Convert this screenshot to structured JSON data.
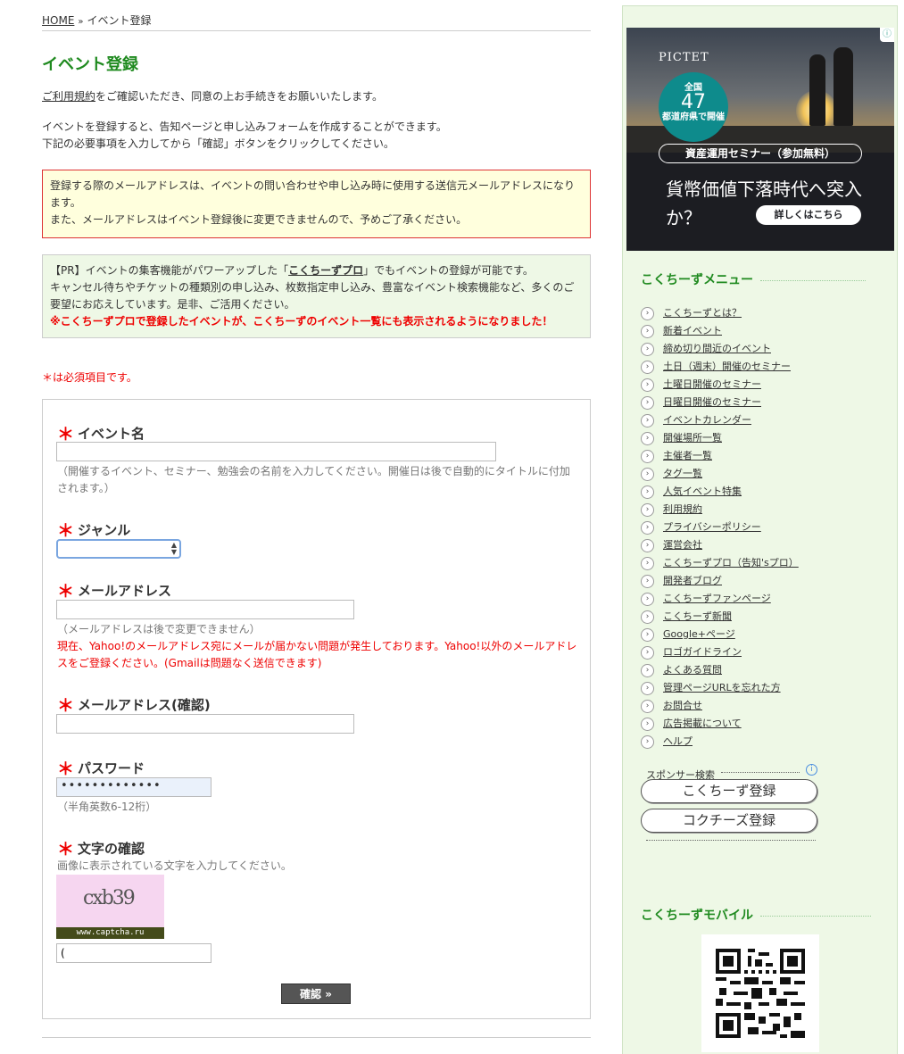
{
  "breadcrumb": {
    "home": "HOME",
    "sep": "»",
    "current": "イベント登録"
  },
  "page_title": "イベント登録",
  "intro": {
    "terms_link": "ご利用規約",
    "line1_rest": "をご確認いただき、同意の上お手続きをお願いいたします。",
    "line2": "イベントを登録すると、告知ページと申し込みフォームを作成することができます。",
    "line3": "下記の必要事項を入力してから「確認」ボタンをクリックしてください。"
  },
  "notice": {
    "line1": "登録する際のメールアドレスは、イベントの問い合わせや申し込み時に使用する送信元メールアドレスになります。",
    "line2": "また、メールアドレスはイベント登録後に変更できませんので、予めご了承ください。"
  },
  "pr": {
    "prefix": "【PR】イベントの集客機能がパワーアップした「",
    "pro_link": "こくちーずプロ",
    "suffix": "」でもイベントの登録が可能です。",
    "line2": "キャンセル待ちやチケットの種類別の申し込み、枚数指定申し込み、豊富なイベント検索機能など、多くのご要望にお応えしています。是非、ご活用ください。",
    "red": "※こくちーずプロで登録したイベントが、こくちーずのイベント一覧にも表示されるようになりました！"
  },
  "required_note": "＊は必須項目です。",
  "form": {
    "star": "＊",
    "event_name": {
      "label": "イベント名",
      "value": "",
      "help": "（開催するイベント、セミナー、勉強会の名前を入力してください。開催日は後で自動的にタイトルに付加されます。）"
    },
    "genre": {
      "label": "ジャンル",
      "value": ""
    },
    "email": {
      "label": "メールアドレス",
      "value": "",
      "help": "（メールアドレスは後で変更できません）",
      "warning": "現在、Yahoo!のメールアドレス宛にメールが届かない問題が発生しております。Yahoo!以外のメールアドレスをご登録ください。(Gmailは問題なく送信できます)"
    },
    "email_confirm": {
      "label": "メールアドレス(確認)",
      "value": ""
    },
    "password": {
      "label": "パスワード",
      "value": "•••••••••••••",
      "help": "（半角英数6-12桁）"
    },
    "captcha": {
      "label": "文字の確認",
      "help": "画像に表示されている文字を入力してください。",
      "image_text": "cxb39",
      "image_caption": "www.captcha.ru",
      "value": "("
    },
    "submit": "確認 »"
  },
  "ad": {
    "logo": "PICTET",
    "circle_l1": "全国",
    "circle_num": "47",
    "circle_l3": "都道府県で開催",
    "seminar": "資産運用セミナー（参加無料）",
    "headline": "貨幣価値下落時代へ突入か？",
    "cta": "詳しくはこちら",
    "adchoice": "ⓘ"
  },
  "sidebar": {
    "menu_title": "こくちーずメニュー",
    "menu_items": [
      "こくちーずとは？",
      "新着イベント",
      "締め切り間近のイベント",
      "土日（週末）開催のセミナー",
      "土曜日開催のセミナー",
      "日曜日開催のセミナー",
      "イベントカレンダー",
      "開催場所一覧",
      "主催者一覧",
      "タグ一覧",
      "人気イベント特集",
      "利用規約",
      "プライバシーポリシー",
      "運営会社",
      "こくちーずプロ（告知'sプロ）",
      "開発者ブログ",
      "こくちーずファンページ",
      "こくちーず新聞",
      "Google+ページ",
      "ロゴガイドライン",
      "よくある質問",
      "管理ページURLを忘れた方",
      "お問合せ",
      "広告掲載について",
      "ヘルプ"
    ],
    "sponsor_label": "スポンサー検索",
    "sponsor_buttons": [
      "こくちーず登録",
      "コクチーズ登録"
    ],
    "mobile_title": "こくちーずモバイル"
  }
}
